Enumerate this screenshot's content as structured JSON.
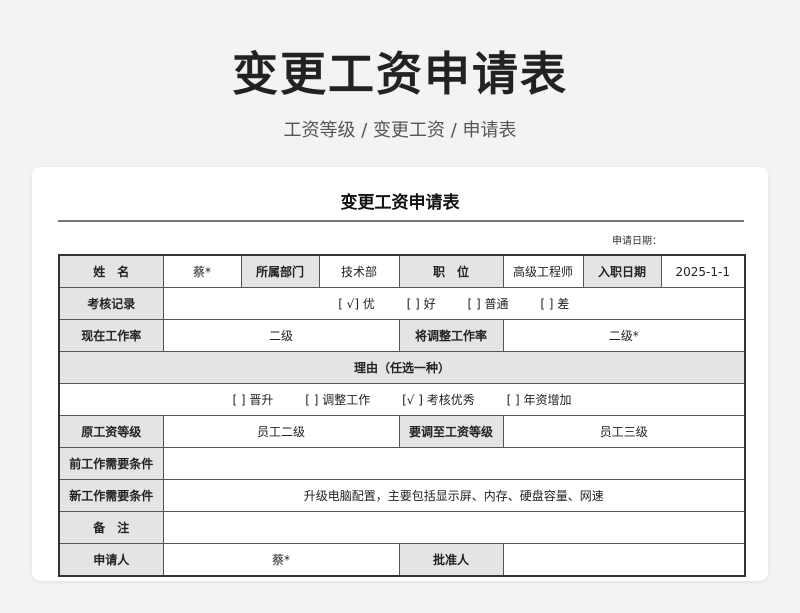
{
  "header": {
    "title": "变更工资申请表",
    "subtitle": "工资等级 / 变更工资 / 申请表"
  },
  "form": {
    "title": "变更工资申请表",
    "apply_date_label": "申请日期：",
    "labels": {
      "name": "姓　名",
      "department": "所属部门",
      "position": "职　位",
      "hire_date": "入职日期",
      "assessment": "考核记录",
      "current_rate": "现在工作率",
      "adjusted_rate": "将调整工作率",
      "reason": "理由（任选一种）",
      "original_grade": "原工资等级",
      "target_grade": "要调至工资等级",
      "prev_conditions": "前工作需要条件",
      "new_conditions": "新工作需要条件",
      "remarks": "备　注",
      "applicant": "申请人",
      "approver": "批准人"
    },
    "values": {
      "name": "蔡*",
      "department": "技术部",
      "position": "高级工程师",
      "hire_date": "2025-1-1",
      "current_rate": "二级",
      "adjusted_rate": "二级*",
      "original_grade": "员工二级",
      "target_grade": "员工三级",
      "prev_conditions": "",
      "new_conditions": "升级电脑配置，主要包括显示屏、内存、硬盘容量、网速",
      "remarks": "",
      "applicant": "蔡*",
      "approver": ""
    },
    "assessment_options": [
      "[ √]  优",
      "[  ]  好",
      "[  ]  普通",
      "[  ]  差"
    ],
    "reason_options": [
      "[  ]  晋升",
      "[  ]  调整工作",
      "[√  ]  考核优秀",
      "[  ]  年资增加"
    ]
  }
}
